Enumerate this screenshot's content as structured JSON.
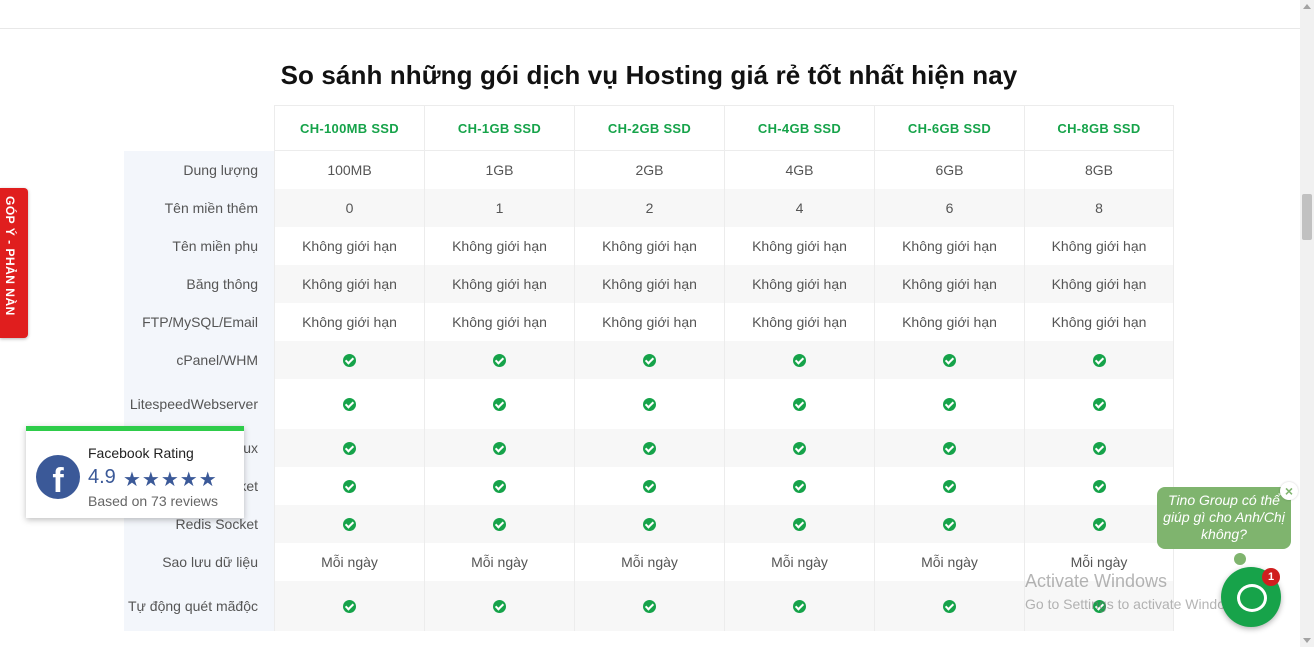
{
  "page": {
    "title": "So sánh những gói dịch vụ Hosting giá rẻ tốt nhất hiện nay"
  },
  "table": {
    "columns": [
      "CH-100MB SSD",
      "CH-1GB SSD",
      "CH-2GB SSD",
      "CH-4GB SSD",
      "CH-6GB SSD",
      "CH-8GB SSD"
    ],
    "rows": [
      {
        "label": "Dung lượng",
        "values": [
          "100MB",
          "1GB",
          "2GB",
          "4GB",
          "6GB",
          "8GB"
        ]
      },
      {
        "label": "Tên miền thêm",
        "values": [
          "0",
          "1",
          "2",
          "4",
          "6",
          "8"
        ]
      },
      {
        "label": "Tên miền phụ",
        "values": [
          "Không giới hạn",
          "Không giới hạn",
          "Không giới hạn",
          "Không giới hạn",
          "Không giới hạn",
          "Không giới hạn"
        ]
      },
      {
        "label": "Băng thông",
        "values": [
          "Không giới hạn",
          "Không giới hạn",
          "Không giới hạn",
          "Không giới hạn",
          "Không giới hạn",
          "Không giới hạn"
        ]
      },
      {
        "label": "FTP/MySQL/Email",
        "values": [
          "Không giới hạn",
          "Không giới hạn",
          "Không giới hạn",
          "Không giới hạn",
          "Không giới hạn",
          "Không giới hạn"
        ]
      },
      {
        "label": "cPanel/WHM",
        "values": [
          "✓",
          "✓",
          "✓",
          "✓",
          "✓",
          "✓"
        ]
      },
      {
        "label_line1": "Litespeed",
        "label_line2": "Webserver",
        "values": [
          "✓",
          "✓",
          "✓",
          "✓",
          "✓",
          "✓"
        ]
      },
      {
        "label": "ux",
        "values": [
          "✓",
          "✓",
          "✓",
          "✓",
          "✓",
          "✓"
        ]
      },
      {
        "label": "ket",
        "values": [
          "✓",
          "✓",
          "✓",
          "✓",
          "✓",
          "✓"
        ]
      },
      {
        "label": "Redis Socket",
        "values": [
          "✓",
          "✓",
          "✓",
          "✓",
          "✓",
          "✓"
        ]
      },
      {
        "label": "Sao lưu dữ liệu",
        "values": [
          "Mỗi ngày",
          "Mỗi ngày",
          "Mỗi ngày",
          "Mỗi ngày",
          "Mỗi ngày",
          "Mỗi ngày"
        ]
      },
      {
        "label_line1": "Tự động quét mã",
        "label_line2": "độc",
        "values": [
          "✓",
          "✓",
          "✓",
          "✓",
          "✓",
          "✓"
        ]
      }
    ]
  },
  "feedback_tab": {
    "label": "GÓP Ý - PHẢN NÀN"
  },
  "facebook_rating": {
    "title": "Facebook Rating",
    "score": "4.9",
    "stars": "★★★★★",
    "rating_stars": 5,
    "based_on": "Based on 73 reviews",
    "logo_letter": "f"
  },
  "chat": {
    "bubble_text": "Tino Group có thể giúp gì cho Anh/Chị không?",
    "close": "×",
    "badge": "1"
  },
  "watermark": {
    "line1": "Activate Windows",
    "line2": "Go to Settings to activate Windows."
  },
  "colors": {
    "accent_green": "#16a34a",
    "feedback_red": "#e01e1e",
    "facebook_blue": "#3b5998",
    "chat_bubble": "#7fb46e"
  }
}
